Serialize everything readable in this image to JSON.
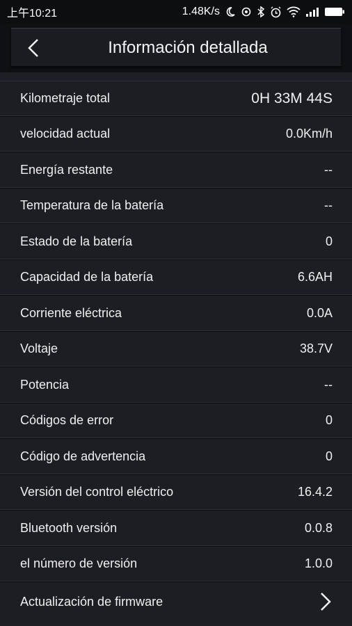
{
  "status_bar": {
    "time": "上午10:21",
    "net_speed": "1.48K/s",
    "icons": [
      "moon-icon",
      "sync-icon",
      "bluetooth-icon",
      "alarm-icon",
      "wifi-icon",
      "signal-icon",
      "battery-icon"
    ]
  },
  "header": {
    "title": "Información detallada",
    "back_icon": "chevron-left-icon"
  },
  "rows": [
    {
      "label": "Kilometraje total",
      "value": "0H 33M 44S"
    },
    {
      "label": "velocidad actual",
      "value": "0.0Km/h"
    },
    {
      "label": "Energía restante",
      "value": "--"
    },
    {
      "label": "Temperatura de la batería",
      "value": "--"
    },
    {
      "label": "Estado de la batería",
      "value": "0"
    },
    {
      "label": "Capacidad de la batería",
      "value": "6.6AH"
    },
    {
      "label": "Corriente eléctrica",
      "value": "0.0A"
    },
    {
      "label": "Voltaje",
      "value": "38.7V"
    },
    {
      "label": "Potencia",
      "value": "--"
    },
    {
      "label": "Códigos de error",
      "value": "0"
    },
    {
      "label": "Código de advertencia",
      "value": "0"
    },
    {
      "label": "Versión del control eléctrico",
      "value": "16.4.2"
    },
    {
      "label": "Bluetooth versión",
      "value": "0.0.8"
    },
    {
      "label": "el número de versión",
      "value": "1.0.0"
    }
  ],
  "firmware": {
    "label": "Actualización de firmware",
    "icon": "chevron-right-icon"
  }
}
